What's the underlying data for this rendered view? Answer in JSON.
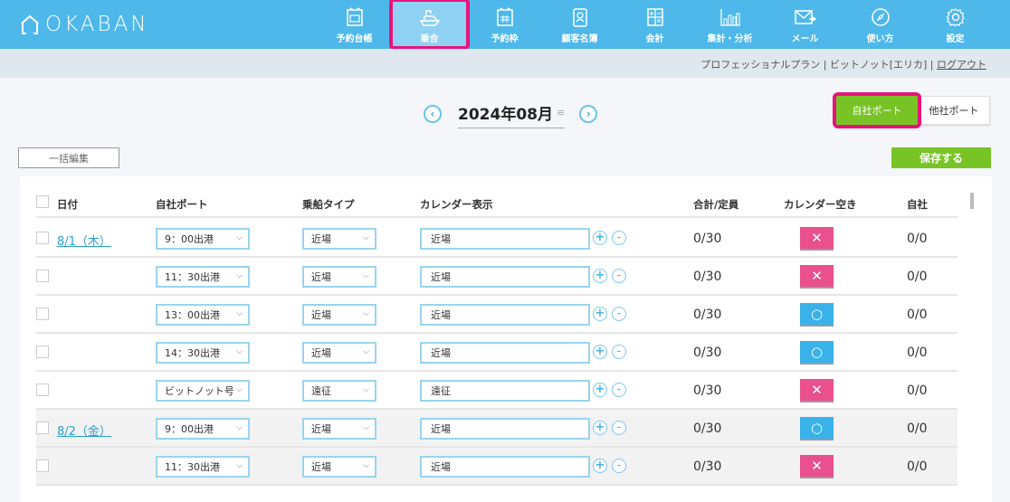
{
  "app": {
    "logo_text": "OKABAN"
  },
  "nav": [
    {
      "label": "予約台帳",
      "icon": "calendar-icon",
      "active": false
    },
    {
      "label": "乗合",
      "icon": "boat-icon",
      "active": true
    },
    {
      "label": "予約枠",
      "icon": "calendar-grid-icon",
      "active": false
    },
    {
      "label": "顧客名簿",
      "icon": "address-book-icon",
      "active": false
    },
    {
      "label": "会計",
      "icon": "calculator-icon",
      "active": false
    },
    {
      "label": "集計・分析",
      "icon": "bar-chart-icon",
      "active": false
    },
    {
      "label": "メール",
      "icon": "mail-icon",
      "active": false
    },
    {
      "label": "使い方",
      "icon": "compass-icon",
      "active": false
    },
    {
      "label": "設定",
      "icon": "gear-icon",
      "active": false
    }
  ],
  "user": {
    "plan": "プロフェッショナルプラン",
    "separator": " | ",
    "account": "ビットノット[エリカ]",
    "logout": "ログアウト"
  },
  "month_nav": {
    "month": "2024年08月",
    "prev_icon": "chevron-left-icon",
    "next_icon": "chevron-right-icon"
  },
  "port_toggle": {
    "own": "自社ポート",
    "other": "他社ポート",
    "selected": "own"
  },
  "toolbar": {
    "bulk_edit": "一括編集",
    "save": "保存する"
  },
  "table": {
    "headers": {
      "date": "日付",
      "port": "自社ポート",
      "type": "乗船タイプ",
      "calendar": "カレンダー表示",
      "total": "合計/定員",
      "availability": "カレンダー空き",
      "own": "自社"
    },
    "rows": [
      {
        "date": "8/1（木）",
        "port": "9：00出港",
        "type": "近場",
        "calendar": "近場",
        "total": "0/30",
        "available": false,
        "avail_symbol": "✕",
        "own": "0/0",
        "shaded": false
      },
      {
        "date": "",
        "port": "11：30出港",
        "type": "近場",
        "calendar": "近場",
        "total": "0/30",
        "available": false,
        "avail_symbol": "✕",
        "own": "0/0",
        "shaded": false
      },
      {
        "date": "",
        "port": "13：00出港",
        "type": "近場",
        "calendar": "近場",
        "total": "0/30",
        "available": true,
        "avail_symbol": "○",
        "own": "0/0",
        "shaded": false
      },
      {
        "date": "",
        "port": "14：30出港",
        "type": "近場",
        "calendar": "近場",
        "total": "0/30",
        "available": true,
        "avail_symbol": "○",
        "own": "0/0",
        "shaded": false
      },
      {
        "date": "",
        "port": "ビットノット号",
        "type": "遠征",
        "calendar": "遠征",
        "total": "0/30",
        "available": false,
        "avail_symbol": "✕",
        "own": "0/0",
        "shaded": false
      },
      {
        "date": "8/2（金）",
        "port": "9：00出港",
        "type": "近場",
        "calendar": "近場",
        "total": "0/30",
        "available": true,
        "avail_symbol": "○",
        "own": "0/0",
        "shaded": true
      },
      {
        "date": "",
        "port": "11：30出港",
        "type": "近場",
        "calendar": "近場",
        "total": "0/30",
        "available": false,
        "avail_symbol": "✕",
        "own": "0/0",
        "shaded": true
      }
    ]
  },
  "colors": {
    "header_bg": "#4fb8ea",
    "highlight": "#e8137a",
    "green": "#78c427",
    "unavailable": "#ea4f8e",
    "available": "#39b2ea",
    "link": "#2a9fd6"
  }
}
